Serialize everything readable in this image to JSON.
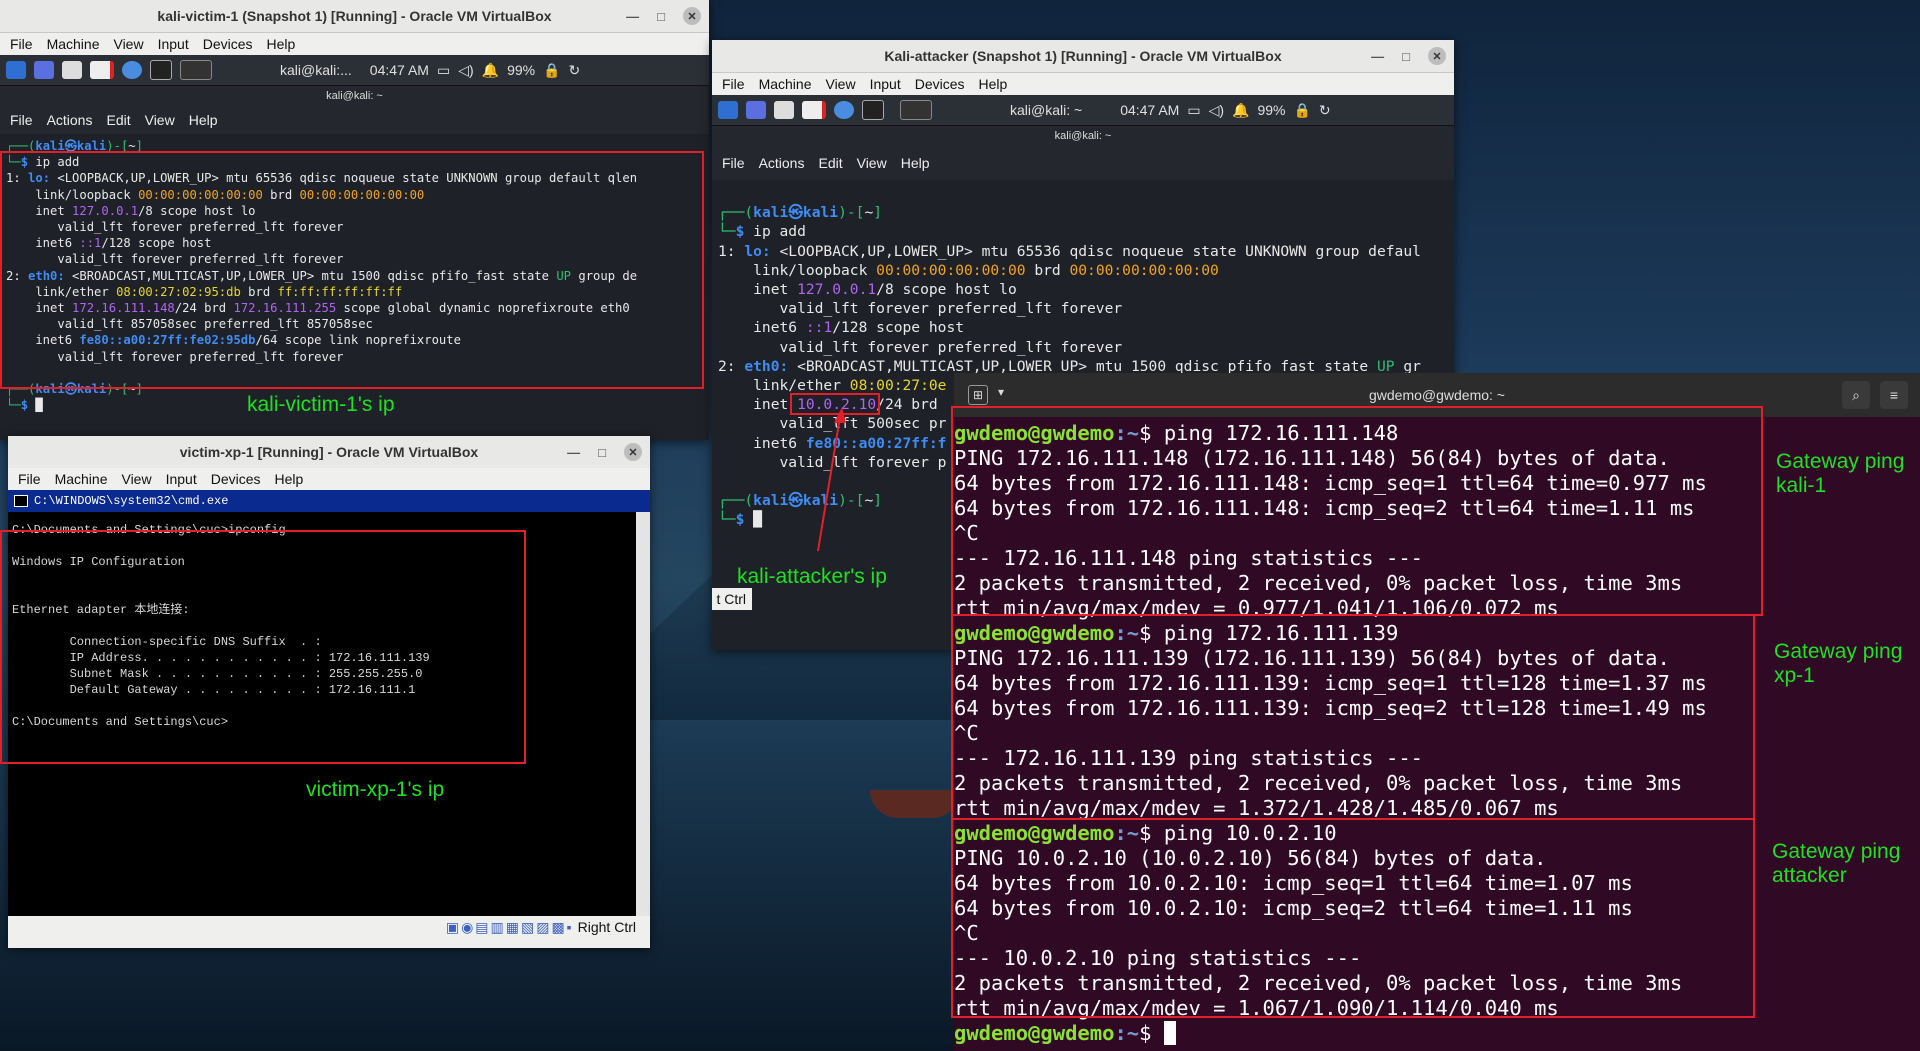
{
  "victim_window": {
    "title": "kali-victim-1 (Snapshot 1) [Running] - Oracle VM VirtualBox",
    "menu": [
      "File",
      "Machine",
      "View",
      "Input",
      "Devices",
      "Help"
    ],
    "taskbar_terminal": "kali@kali:...",
    "time": "04:47 AM",
    "battery": "99%",
    "term_title": "kali@kali: ~",
    "term_menu": [
      "File",
      "Actions",
      "Edit",
      "View",
      "Help"
    ],
    "prompt_user": "kali",
    "prompt_host": "kali",
    "command": "ip add",
    "lines": {
      "l1_prefix": "1: ",
      "l1_if": "lo:",
      "l1_rest": " <LOOPBACK,UP,LOWER_UP> mtu 65536 qdisc noqueue state UNKNOWN group default qlen",
      "l2a": "    link/loopback ",
      "l2b": "00:00:00:00:00:00",
      "l2c": " brd ",
      "l2d": "00:00:00:00:00:00",
      "l3a": "    inet ",
      "l3b": "127.0.0.1",
      "l3c": "/8 scope host lo",
      "l4": "       valid_lft forever preferred_lft forever",
      "l5a": "    inet6 ",
      "l5b": "::1",
      "l5c": "/128 scope host",
      "l6": "       valid_lft forever preferred_lft forever",
      "l7_prefix": "2: ",
      "l7_if": "eth0:",
      "l7_mid": " <BROADCAST,MULTICAST,UP,LOWER_UP> mtu 1500 qdisc pfifo_fast state ",
      "l7_up": "UP",
      "l7_end": " group de",
      "l8a": "    link/ether ",
      "l8b": "08:00:27:02:95:db",
      "l8c": " brd ",
      "l8d": "ff:ff:ff:ff:ff:ff",
      "l9a": "    inet ",
      "l9b": "172.16.111.148",
      "l9c": "/24 brd ",
      "l9d": "172.16.111.255",
      "l9e": " scope global dynamic noprefixroute eth0",
      "l10": "       valid_lft 857058sec preferred_lft 857058sec",
      "l11a": "    inet6 ",
      "l11b": "fe80::a00:27ff:fe02:95db",
      "l11c": "/64 scope link noprefixroute",
      "l12": "       valid_lft forever preferred_lft forever"
    }
  },
  "attacker_window": {
    "title": "Kali-attacker (Snapshot 1) [Running] - Oracle VM VirtualBox",
    "menu": [
      "File",
      "Machine",
      "View",
      "Input",
      "Devices",
      "Help"
    ],
    "taskbar_terminal": "kali@kali: ~",
    "time": "04:47 AM",
    "battery": "99%",
    "term_title": "kali@kali: ~",
    "term_menu": [
      "File",
      "Actions",
      "Edit",
      "View",
      "Help"
    ],
    "command": "ip add",
    "lines": {
      "l1_rest": " <LOOPBACK,UP,LOWER_UP> mtu 65536 qdisc noqueue state UNKNOWN group defaul",
      "l7_mid": " <BROADCAST,MULTICAST,UP,LOWER_UP> mtu 1500 qdisc pfifo_fast state ",
      "l7_end": " gr",
      "l8b": "08:00:27:0e",
      "l9b": "10.0.2.10",
      "l9c": "/24 brd",
      "l10": "       valid_lft 500sec pr",
      "l11b": "fe80::a00:27ff:f",
      "l12": "       valid_lft forever p"
    },
    "hidden_status": "t Ctrl"
  },
  "xp_window": {
    "title": "victim-xp-1 [Running] - Oracle VM VirtualBox",
    "menu": [
      "File",
      "Machine",
      "View",
      "Input",
      "Devices",
      "Help"
    ],
    "cmd_title": "C:\\WINDOWS\\system32\\cmd.exe",
    "lines": [
      "C:\\Documents and Settings\\cuc>ipconfig",
      "",
      "Windows IP Configuration",
      "",
      "",
      "Ethernet adapter 本地连接:",
      "",
      "        Connection-specific DNS Suffix  . :",
      "        IP Address. . . . . . . . . . . . : 172.16.111.139",
      "        Subnet Mask . . . . . . . . . . . : 255.255.255.0",
      "        Default Gateway . . . . . . . . . : 172.16.111.1",
      "",
      "C:\\Documents and Settings\\cuc>"
    ],
    "status_right": "Right Ctrl"
  },
  "gateway_window": {
    "title": "gwdemo@gwdemo: ~",
    "prompt_user": "gwdemo@gwdemo",
    "prompt_path": ":~",
    "blocks": [
      {
        "cmd": "ping 172.16.111.148",
        "lines": [
          "PING 172.16.111.148 (172.16.111.148) 56(84) bytes of data.",
          "64 bytes from 172.16.111.148: icmp_seq=1 ttl=64 time=0.977 ms",
          "64 bytes from 172.16.111.148: icmp_seq=2 ttl=64 time=1.11 ms",
          "^C",
          "--- 172.16.111.148 ping statistics ---",
          "2 packets transmitted, 2 received, 0% packet loss, time 3ms",
          "rtt min/avg/max/mdev = 0.977/1.041/1.106/0.072 ms"
        ]
      },
      {
        "cmd": "ping 172.16.111.139",
        "lines": [
          "PING 172.16.111.139 (172.16.111.139) 56(84) bytes of data.",
          "64 bytes from 172.16.111.139: icmp_seq=1 ttl=128 time=1.37 ms",
          "64 bytes from 172.16.111.139: icmp_seq=2 ttl=128 time=1.49 ms",
          "^C",
          "--- 172.16.111.139 ping statistics ---",
          "2 packets transmitted, 2 received, 0% packet loss, time 3ms",
          "rtt min/avg/max/mdev = 1.372/1.428/1.485/0.067 ms"
        ]
      },
      {
        "cmd": "ping 10.0.2.10",
        "lines": [
          "PING 10.0.2.10 (10.0.2.10) 56(84) bytes of data.",
          "64 bytes from 10.0.2.10: icmp_seq=1 ttl=64 time=1.07 ms",
          "64 bytes from 10.0.2.10: icmp_seq=2 ttl=64 time=1.11 ms",
          "^C",
          "--- 10.0.2.10 ping statistics ---",
          "2 packets transmitted, 2 received, 0% packet loss, time 3ms",
          "rtt min/avg/max/mdev = 1.067/1.090/1.114/0.040 ms"
        ]
      }
    ]
  },
  "annotations": {
    "victim_ip": "kali-victim-1's ip",
    "attacker_ip": "kali-attacker's ip",
    "xp_ip": "victim-xp-1's ip",
    "gw_kali": "Gateway ping kali-1",
    "gw_xp": "Gateway ping xp-1",
    "gw_attacker": "Gateway ping attacker"
  },
  "colors": {
    "annotation": "#1fe022",
    "highlight_box": "#e3202a",
    "gateway_bg": "#300a24"
  }
}
